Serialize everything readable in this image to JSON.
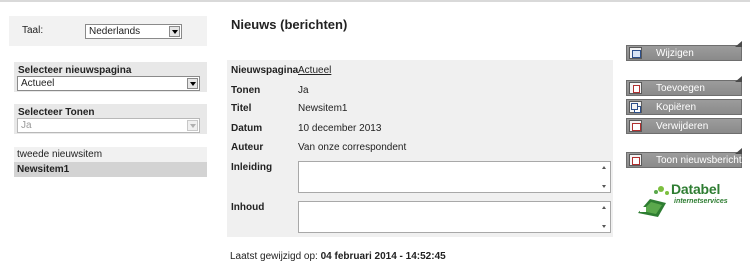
{
  "language": {
    "label": "Taal:",
    "selected": "Nederlands"
  },
  "news_page_select": {
    "title": "Selecteer nieuwspagina",
    "selected": "Actueel"
  },
  "show_select": {
    "title": "Selecteer Tonen",
    "selected": "Ja"
  },
  "news_list": [
    "tweede nieuwsitem",
    "Newsitem1"
  ],
  "main": {
    "title": "Nieuws (berichten)",
    "fields": {
      "news_page": {
        "label": "Nieuwspagina",
        "value": "Actueel"
      },
      "show": {
        "label": "Tonen",
        "value": "Ja"
      },
      "title": {
        "label": "Titel",
        "value": "Newsitem1"
      },
      "date": {
        "label": "Datum",
        "value": "10 december 2013"
      },
      "author": {
        "label": "Auteur",
        "value": "Van onze correspondent"
      },
      "intro": {
        "label": "Inleiding",
        "value": ""
      },
      "content": {
        "label": "Inhoud",
        "value": ""
      }
    },
    "last_modified_label": "Laatst gewijzigd op:",
    "last_modified_value": "04 februari 2014 - 14:52:45"
  },
  "actions": {
    "edit": "Wijzigen",
    "add": "Toevoegen",
    "copy": "Kopiëren",
    "delete": "Verwijderen",
    "show_news": "Toon nieuwsbericht"
  },
  "logo": {
    "name": "Databel",
    "tagline": "internetservices",
    "color": "#2e7d32"
  }
}
